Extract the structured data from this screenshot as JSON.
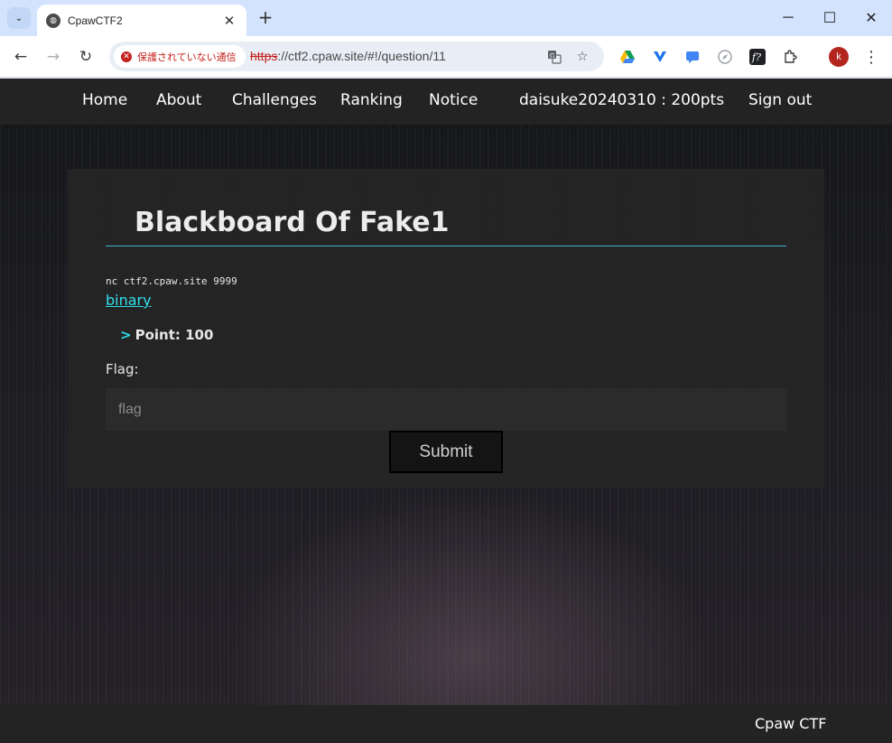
{
  "browser": {
    "tab": {
      "title": "CpawCTF2",
      "close_glyph": "✕"
    },
    "new_tab_glyph": "+",
    "window_controls": {
      "minimize": "─",
      "maximize": "☐",
      "close": "✕"
    },
    "nav": {
      "back": "←",
      "forward": "→",
      "reload": "↻"
    },
    "security_label": "保護されていない通信",
    "url_scheme": "https",
    "url_rest": "://ctf2.cpaw.site/#!/question/11",
    "icons": [
      "translate-icon",
      "star-icon",
      "google-drive-icon",
      "vpn-icon",
      "chat-icon",
      "compass-icon",
      "font-icon",
      "extensions-icon",
      "menu-icon"
    ],
    "profile_initial": "k",
    "menu_glyph": "⋮"
  },
  "site": {
    "nav": {
      "home": "Home",
      "about": "About",
      "challenges": "Challenges",
      "ranking": "Ranking",
      "notice": "Notice",
      "user": "daisuke20240310 : 200pts",
      "signout": "Sign out"
    },
    "question": {
      "title": "Blackboard Of Fake1",
      "body": "nc ctf2.cpaw.site 9999",
      "link": "binary",
      "point_marker": ">",
      "point_label": "Point: 100",
      "flag_label": "Flag:",
      "flag_placeholder": "flag",
      "submit_label": "Submit"
    },
    "footer": "Cpaw CTF",
    "colors": {
      "accent": "#2fe0ea",
      "nav_bg": "#232323",
      "panel_bg": "#262626",
      "rule": "#3fb3c9"
    }
  }
}
